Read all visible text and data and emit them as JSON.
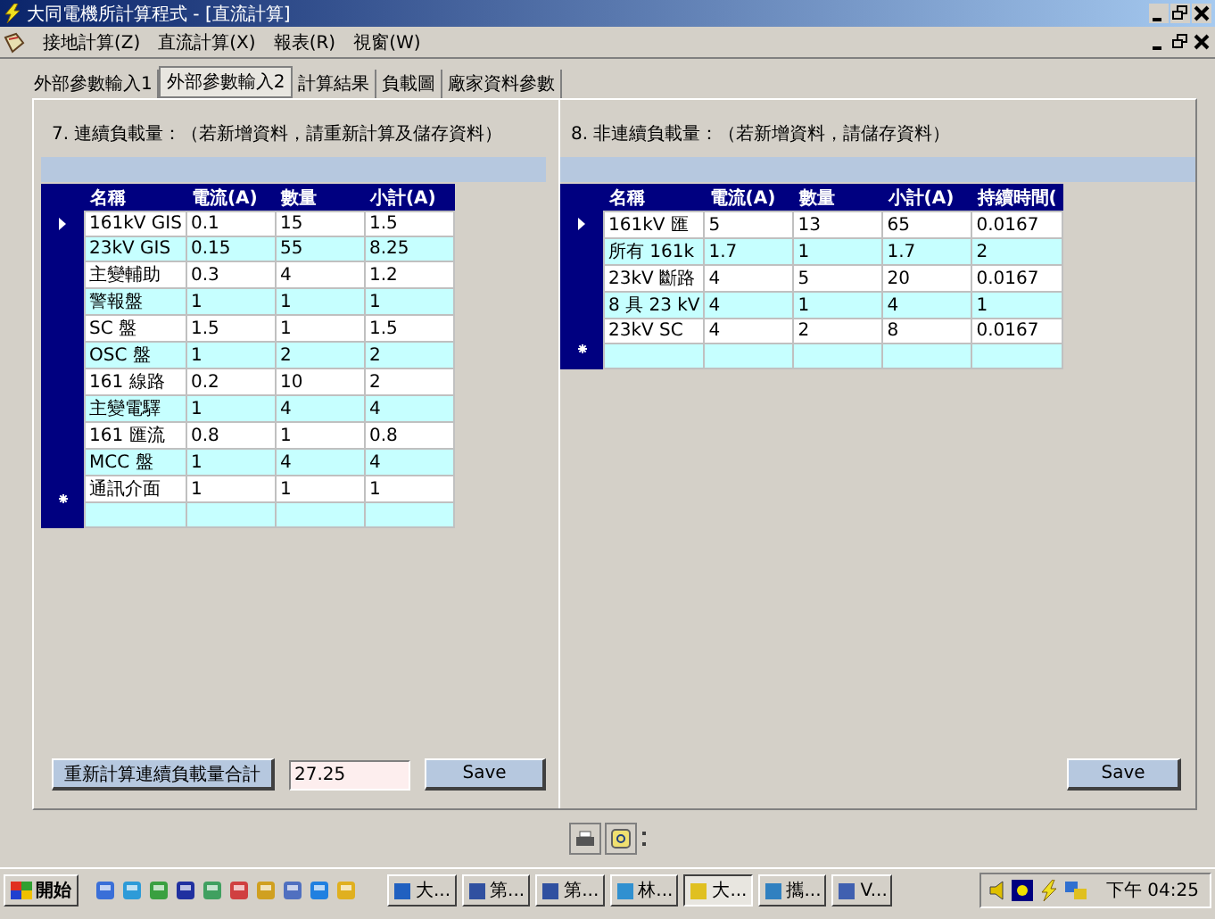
{
  "window": {
    "title": "大同電機所計算程式 - [直流計算]"
  },
  "menu": [
    "接地計算(Z)",
    "直流計算(X)",
    "報表(R)",
    "視窗(W)"
  ],
  "tabs": [
    {
      "label": "外部參數輸入1",
      "selected": false
    },
    {
      "label": "外部參數輸入2",
      "selected": true
    },
    {
      "label": "計算結果",
      "selected": false
    },
    {
      "label": "負載圖",
      "selected": false
    },
    {
      "label": "廠家資料參數",
      "selected": false
    }
  ],
  "continuous": {
    "title": "7. 連續負載量：（若新增資料，請重新計算及儲存資料）",
    "columns": [
      "名稱",
      "電流(A)",
      "數量",
      "小計(A)"
    ],
    "rows": [
      {
        "selected": true,
        "cells": [
          "161kV GIS",
          "0.1",
          "15",
          "1.5"
        ]
      },
      {
        "selected": false,
        "cells": [
          "23kV GIS",
          "0.15",
          "55",
          "8.25"
        ]
      },
      {
        "selected": false,
        "cells": [
          "主變輔助",
          "0.3",
          "4",
          "1.2"
        ]
      },
      {
        "selected": false,
        "cells": [
          "警報盤",
          "1",
          "1",
          "1"
        ]
      },
      {
        "selected": false,
        "cells": [
          "SC 盤",
          "1.5",
          "1",
          "1.5"
        ]
      },
      {
        "selected": false,
        "cells": [
          "OSC 盤",
          "1",
          "2",
          "2"
        ]
      },
      {
        "selected": false,
        "cells": [
          "161 線路",
          "0.2",
          "10",
          "2"
        ]
      },
      {
        "selected": false,
        "cells": [
          "主變電驛",
          "1",
          "4",
          "4"
        ]
      },
      {
        "selected": false,
        "cells": [
          "161 匯流",
          "0.8",
          "1",
          "0.8"
        ]
      },
      {
        "selected": false,
        "cells": [
          "MCC 盤",
          "1",
          "4",
          "4"
        ]
      },
      {
        "selected": false,
        "cells": [
          "通訊介面",
          "1",
          "1",
          "1"
        ]
      }
    ],
    "has_new_row": true,
    "recalc_button": "重新計算連續負載量合計",
    "total": "27.25",
    "save_button": "Save"
  },
  "noncontinuous": {
    "title": "8. 非連續負載量：（若新增資料，請儲存資料）",
    "columns": [
      "名稱",
      "電流(A)",
      "數量",
      "小計(A)",
      "持續時間("
    ],
    "rows": [
      {
        "selected": true,
        "cells": [
          "161kV 匯",
          "5",
          "13",
          "65",
          "0.0167"
        ]
      },
      {
        "selected": false,
        "cells": [
          "所有 161k",
          "1.7",
          "1",
          "1.7",
          "2"
        ]
      },
      {
        "selected": false,
        "cells": [
          "23kV 斷路",
          "4",
          "5",
          "20",
          "0.0167"
        ]
      },
      {
        "selected": false,
        "cells": [
          "8 具 23 kV",
          "4",
          "1",
          "4",
          "1"
        ]
      },
      {
        "selected": false,
        "cells": [
          "23kV SC",
          "4",
          "2",
          "8",
          "0.0167"
        ]
      }
    ],
    "has_new_row": true,
    "save_button": "Save"
  },
  "taskbar": {
    "start": "開始",
    "tasks": [
      {
        "label": "大...",
        "selected": false
      },
      {
        "label": "第...",
        "selected": false
      },
      {
        "label": "第...",
        "selected": false
      },
      {
        "label": "林...",
        "selected": false
      },
      {
        "label": "大...",
        "selected": true
      },
      {
        "label": "攜...",
        "selected": false
      },
      {
        "label": "V...",
        "selected": false
      }
    ],
    "clock": "下午 04:25"
  }
}
